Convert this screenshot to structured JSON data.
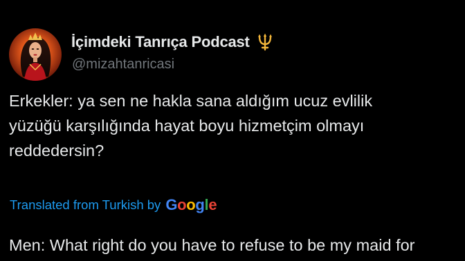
{
  "author": {
    "display_name": "İçimdeki Tanrıça Podcast",
    "handle": "@mizahtanricasi",
    "badge_icon": "trident-icon"
  },
  "tweet": {
    "text_lines": [
      "Erkekler: ya sen ne hakla sana aldığım ucuz evlilik",
      "yüzüğü karşılığında hayat boyu hizmetçim olmayı",
      "reddedersin?"
    ]
  },
  "translation": {
    "label": "Translated from Turkish by",
    "provider_letters": [
      "G",
      "o",
      "o",
      "g",
      "l",
      "e"
    ],
    "provider_colors": [
      "#4285f4",
      "#ea4335",
      "#fbbc05",
      "#4285f4",
      "#34a853",
      "#ea4335"
    ],
    "text": "Men: What right do you have to refuse to be my maid for"
  },
  "colors": {
    "background": "#000000",
    "primary_text": "#e7e9ea",
    "secondary_text": "#71767b",
    "link_blue": "#1d9bf0",
    "badge_gold": "#f2b53a"
  }
}
